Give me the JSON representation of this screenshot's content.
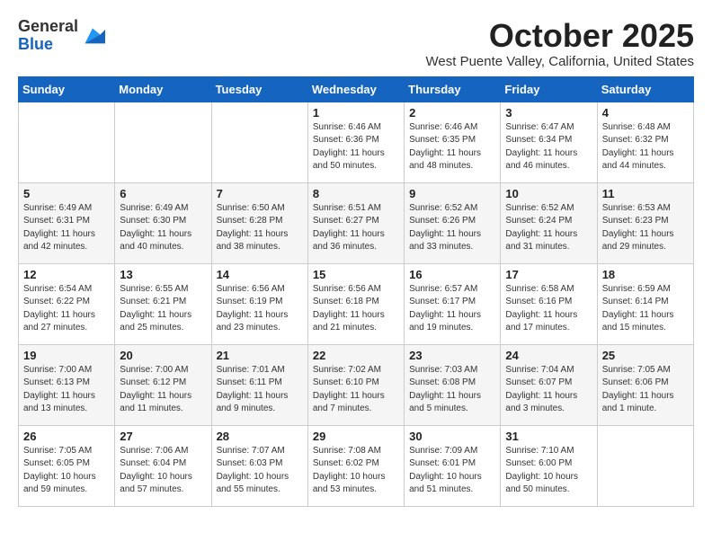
{
  "header": {
    "logo_line1": "General",
    "logo_line2": "Blue",
    "month": "October 2025",
    "location": "West Puente Valley, California, United States"
  },
  "weekdays": [
    "Sunday",
    "Monday",
    "Tuesday",
    "Wednesday",
    "Thursday",
    "Friday",
    "Saturday"
  ],
  "weeks": [
    [
      {
        "day": "",
        "info": ""
      },
      {
        "day": "",
        "info": ""
      },
      {
        "day": "",
        "info": ""
      },
      {
        "day": "1",
        "info": "Sunrise: 6:46 AM\nSunset: 6:36 PM\nDaylight: 11 hours\nand 50 minutes."
      },
      {
        "day": "2",
        "info": "Sunrise: 6:46 AM\nSunset: 6:35 PM\nDaylight: 11 hours\nand 48 minutes."
      },
      {
        "day": "3",
        "info": "Sunrise: 6:47 AM\nSunset: 6:34 PM\nDaylight: 11 hours\nand 46 minutes."
      },
      {
        "day": "4",
        "info": "Sunrise: 6:48 AM\nSunset: 6:32 PM\nDaylight: 11 hours\nand 44 minutes."
      }
    ],
    [
      {
        "day": "5",
        "info": "Sunrise: 6:49 AM\nSunset: 6:31 PM\nDaylight: 11 hours\nand 42 minutes."
      },
      {
        "day": "6",
        "info": "Sunrise: 6:49 AM\nSunset: 6:30 PM\nDaylight: 11 hours\nand 40 minutes."
      },
      {
        "day": "7",
        "info": "Sunrise: 6:50 AM\nSunset: 6:28 PM\nDaylight: 11 hours\nand 38 minutes."
      },
      {
        "day": "8",
        "info": "Sunrise: 6:51 AM\nSunset: 6:27 PM\nDaylight: 11 hours\nand 36 minutes."
      },
      {
        "day": "9",
        "info": "Sunrise: 6:52 AM\nSunset: 6:26 PM\nDaylight: 11 hours\nand 33 minutes."
      },
      {
        "day": "10",
        "info": "Sunrise: 6:52 AM\nSunset: 6:24 PM\nDaylight: 11 hours\nand 31 minutes."
      },
      {
        "day": "11",
        "info": "Sunrise: 6:53 AM\nSunset: 6:23 PM\nDaylight: 11 hours\nand 29 minutes."
      }
    ],
    [
      {
        "day": "12",
        "info": "Sunrise: 6:54 AM\nSunset: 6:22 PM\nDaylight: 11 hours\nand 27 minutes."
      },
      {
        "day": "13",
        "info": "Sunrise: 6:55 AM\nSunset: 6:21 PM\nDaylight: 11 hours\nand 25 minutes."
      },
      {
        "day": "14",
        "info": "Sunrise: 6:56 AM\nSunset: 6:19 PM\nDaylight: 11 hours\nand 23 minutes."
      },
      {
        "day": "15",
        "info": "Sunrise: 6:56 AM\nSunset: 6:18 PM\nDaylight: 11 hours\nand 21 minutes."
      },
      {
        "day": "16",
        "info": "Sunrise: 6:57 AM\nSunset: 6:17 PM\nDaylight: 11 hours\nand 19 minutes."
      },
      {
        "day": "17",
        "info": "Sunrise: 6:58 AM\nSunset: 6:16 PM\nDaylight: 11 hours\nand 17 minutes."
      },
      {
        "day": "18",
        "info": "Sunrise: 6:59 AM\nSunset: 6:14 PM\nDaylight: 11 hours\nand 15 minutes."
      }
    ],
    [
      {
        "day": "19",
        "info": "Sunrise: 7:00 AM\nSunset: 6:13 PM\nDaylight: 11 hours\nand 13 minutes."
      },
      {
        "day": "20",
        "info": "Sunrise: 7:00 AM\nSunset: 6:12 PM\nDaylight: 11 hours\nand 11 minutes."
      },
      {
        "day": "21",
        "info": "Sunrise: 7:01 AM\nSunset: 6:11 PM\nDaylight: 11 hours\nand 9 minutes."
      },
      {
        "day": "22",
        "info": "Sunrise: 7:02 AM\nSunset: 6:10 PM\nDaylight: 11 hours\nand 7 minutes."
      },
      {
        "day": "23",
        "info": "Sunrise: 7:03 AM\nSunset: 6:08 PM\nDaylight: 11 hours\nand 5 minutes."
      },
      {
        "day": "24",
        "info": "Sunrise: 7:04 AM\nSunset: 6:07 PM\nDaylight: 11 hours\nand 3 minutes."
      },
      {
        "day": "25",
        "info": "Sunrise: 7:05 AM\nSunset: 6:06 PM\nDaylight: 11 hours\nand 1 minute."
      }
    ],
    [
      {
        "day": "26",
        "info": "Sunrise: 7:05 AM\nSunset: 6:05 PM\nDaylight: 10 hours\nand 59 minutes."
      },
      {
        "day": "27",
        "info": "Sunrise: 7:06 AM\nSunset: 6:04 PM\nDaylight: 10 hours\nand 57 minutes."
      },
      {
        "day": "28",
        "info": "Sunrise: 7:07 AM\nSunset: 6:03 PM\nDaylight: 10 hours\nand 55 minutes."
      },
      {
        "day": "29",
        "info": "Sunrise: 7:08 AM\nSunset: 6:02 PM\nDaylight: 10 hours\nand 53 minutes."
      },
      {
        "day": "30",
        "info": "Sunrise: 7:09 AM\nSunset: 6:01 PM\nDaylight: 10 hours\nand 51 minutes."
      },
      {
        "day": "31",
        "info": "Sunrise: 7:10 AM\nSunset: 6:00 PM\nDaylight: 10 hours\nand 50 minutes."
      },
      {
        "day": "",
        "info": ""
      }
    ]
  ]
}
